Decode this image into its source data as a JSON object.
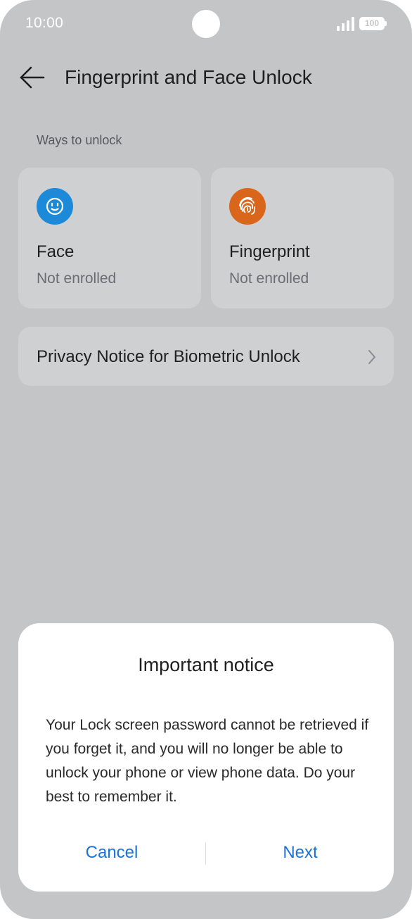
{
  "status_bar": {
    "time": "10:00",
    "battery": "100",
    "icons": [
      "signal-icon",
      "battery-icon"
    ]
  },
  "header": {
    "title": "Fingerprint and Face Unlock",
    "back_icon": "arrow-left-icon"
  },
  "section": {
    "label": "Ways to unlock"
  },
  "cards": [
    {
      "title": "Face",
      "status": "Not enrolled",
      "icon": "face-icon",
      "color": "#1c8ad8"
    },
    {
      "title": "Fingerprint",
      "status": "Not enrolled",
      "icon": "fingerprint-icon",
      "color": "#d9661a"
    }
  ],
  "privacy": {
    "label": "Privacy Notice for Biometric Unlock",
    "icon": "chevron-right-icon"
  },
  "dialog": {
    "title": "Important notice",
    "body": "Your Lock screen password cannot be retrieved if you forget it, and you will no longer be able to unlock your phone or view phone data. Do your best to remember it.",
    "cancel_label": "Cancel",
    "next_label": "Next",
    "accent_color": "#1a73d9"
  }
}
